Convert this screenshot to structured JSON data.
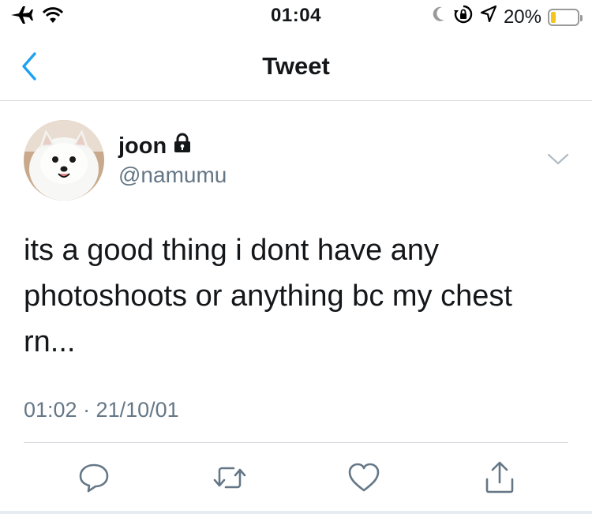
{
  "status_bar": {
    "time": "01:04",
    "battery_percent_label": "20%",
    "battery_level": 0.2,
    "left_icons": [
      "airplane-icon",
      "wifi-icon"
    ],
    "right_icons": [
      "moon-icon",
      "rotation-lock-icon",
      "location-icon"
    ],
    "battery_color": "#f4c51c"
  },
  "nav": {
    "title": "Tweet",
    "back_icon": "chevron-left-icon",
    "accent": "#1da1f2"
  },
  "tweet": {
    "author_name": "joon",
    "protected_icon": "lock-icon",
    "handle": "@namumu",
    "text": "its a good thing i dont have any photoshoots or anything bc my chest rn...",
    "meta": "01:02 · 21/10/01",
    "actions": [
      "reply-icon",
      "retweet-icon",
      "like-icon",
      "share-icon"
    ]
  }
}
